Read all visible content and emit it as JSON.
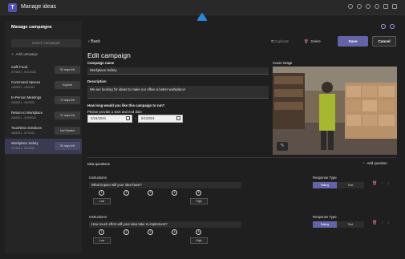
{
  "app": {
    "title": "Manage ideas"
  },
  "sidebar": {
    "title": "Manage campaigns",
    "search_placeholder": "Search campaigns",
    "add_label": "Add campaign",
    "campaigns": [
      {
        "name": "Café Food",
        "dates": "2/7/2021 - 5/21/2021",
        "badge": "53 days left",
        "active": false
      },
      {
        "name": "Communal Spaces",
        "dates": "1/8/2021 - 2/5/2021",
        "badge": "Expired",
        "active": false
      },
      {
        "name": "In-Person Meetings",
        "dates": "2/5/2021 - 4/9/2021",
        "badge": "70 days left",
        "active": false
      },
      {
        "name": "Return to Workplace",
        "dates": "2/6/2021 - 4/15/2021",
        "badge": "37 days left",
        "active": false
      },
      {
        "name": "Touchless Solutions",
        "dates": "4/8/2021 - 5/7/2021",
        "badge": "Not Started",
        "active": false
      },
      {
        "name": "Workplace Safety",
        "dates": "2/7/2021 - 5/1/2021",
        "badge": "53 days left",
        "active": true
      }
    ]
  },
  "toolbar": {
    "back_label": "Back",
    "duplicate_label": "Duplicate",
    "delete_label": "Delete",
    "save_label": "Save",
    "cancel_label": "Cancel"
  },
  "form": {
    "heading": "Edit campaign",
    "name_label": "Campaign name",
    "name_value": "Workplace Safety",
    "description_label": "Description",
    "description_value": "We are looking for ideas to make our office a better workplace!",
    "duration_label": "How long would you like this campaign to run?",
    "duration_hint": "Please provide a start and end date",
    "start_date": "2/24/2021",
    "end_date": "5/1/2021",
    "cover_label": "Cover image"
  },
  "questions": {
    "section_label": "Idea questions",
    "add_label": "Add question",
    "items": [
      {
        "instructions_label": "Instructions",
        "text": "What impact will your idea have?",
        "response_label": "Response Type",
        "rating": "Rating",
        "text_option": "Text",
        "scale": [
          "1",
          "2",
          "3",
          "4",
          "5"
        ],
        "low": "Low",
        "high": "High"
      },
      {
        "instructions_label": "Instructions",
        "text": "How much effort will your idea take to implement?",
        "response_label": "Response Type",
        "rating": "Rating",
        "text_option": "Text",
        "scale": [
          "1",
          "2",
          "3",
          "4",
          "5"
        ],
        "low": "Low",
        "high": "High"
      }
    ]
  },
  "colors": {
    "accent": "#6264a7",
    "delete": "#e07a8a",
    "brand_drop": "#2b88d8"
  }
}
